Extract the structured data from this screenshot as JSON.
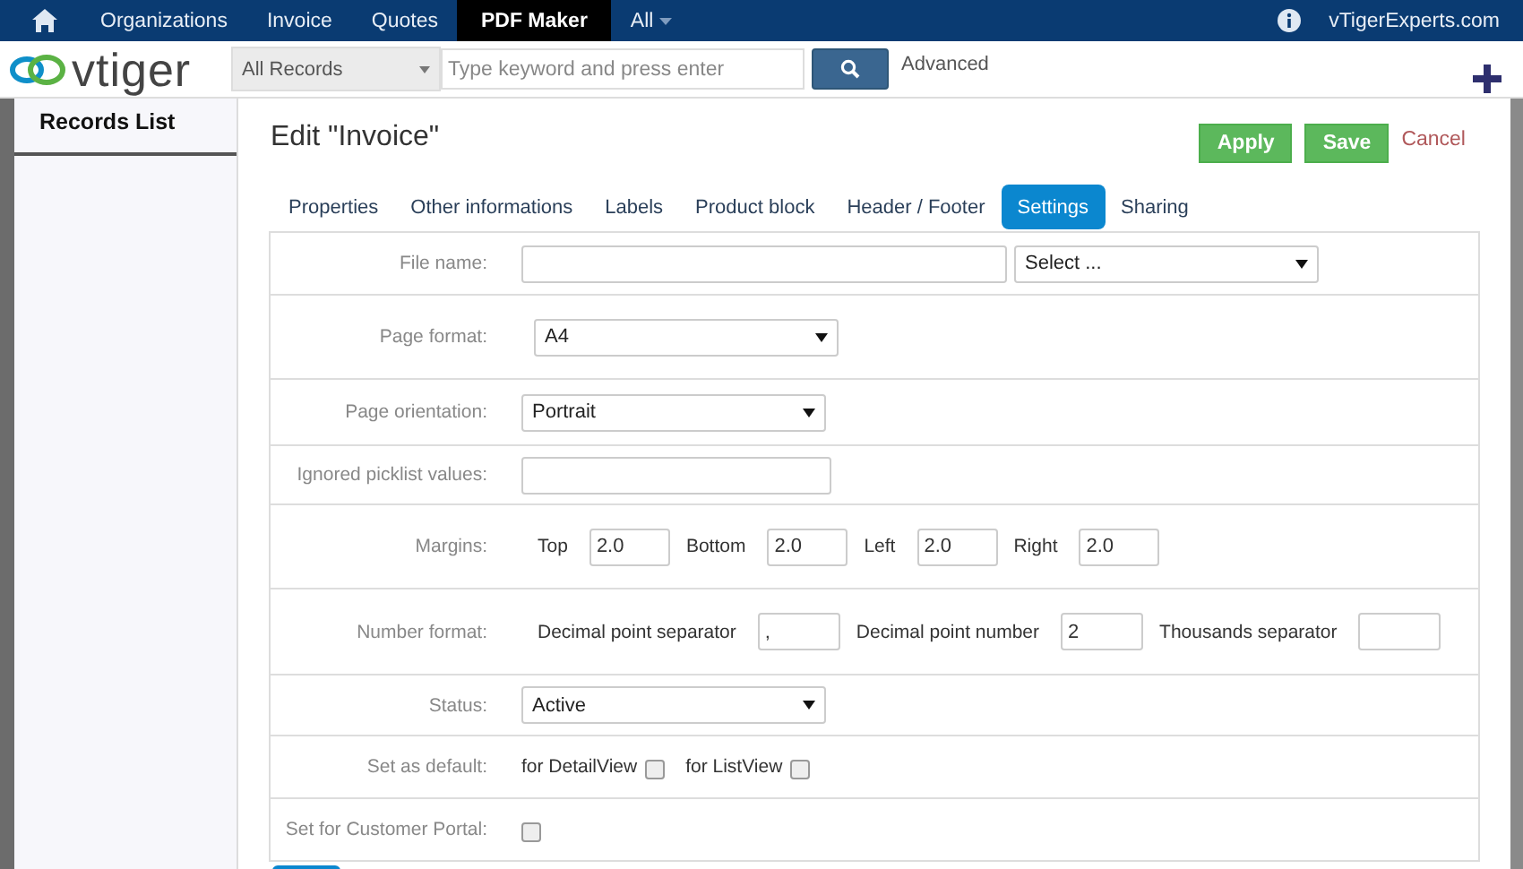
{
  "top_nav": {
    "items": [
      {
        "label": "Organizations",
        "selected": false
      },
      {
        "label": "Invoice",
        "selected": false
      },
      {
        "label": "Quotes",
        "selected": false
      },
      {
        "label": "PDF Maker",
        "selected": true
      },
      {
        "label": "All",
        "selected": false,
        "dropdown": true
      }
    ],
    "site": "vTigerExperts.com"
  },
  "header": {
    "logo": "vtiger",
    "search_scope": "All Records",
    "search": {
      "placeholder": "Type keyword and press enter"
    },
    "advanced": "Advanced"
  },
  "sidebar": {
    "title": "Records List"
  },
  "page_title": "Edit \"Invoice\"",
  "actions": [
    {
      "label": "Apply",
      "kind": "primary"
    },
    {
      "label": "Save",
      "kind": "primary"
    },
    {
      "label": "Cancel",
      "kind": "link"
    }
  ],
  "tabs": [
    {
      "label": "Properties",
      "selected": false
    },
    {
      "label": "Other informations",
      "selected": false
    },
    {
      "label": "Labels",
      "selected": false
    },
    {
      "label": "Product block",
      "selected": false
    },
    {
      "label": "Header / Footer",
      "selected": false
    },
    {
      "label": "Settings",
      "selected": true
    },
    {
      "label": "Sharing",
      "selected": false
    }
  ],
  "rows": [
    {
      "label": "File name:",
      "fields": [
        {
          "kind": "input"
        },
        {
          "kind": "select",
          "value": "Select ..."
        }
      ]
    },
    {
      "label": "Page format:",
      "fields": [
        {
          "kind": "select",
          "value": "A4"
        }
      ]
    },
    {
      "label": "Page orientation:",
      "fields": [
        {
          "kind": "select",
          "value": "Portrait"
        }
      ]
    },
    {
      "label": "Ignored picklist values:",
      "fields": [
        {
          "kind": "input"
        }
      ]
    },
    {
      "label": "Margins:",
      "fields": [
        {
          "kind": "small",
          "label": "Top",
          "value": "2.0"
        },
        {
          "kind": "small",
          "label": "Bottom",
          "value": "2.0"
        },
        {
          "kind": "small",
          "label": "Left",
          "value": "2.0"
        },
        {
          "kind": "small",
          "label": "Right",
          "value": "2.0"
        }
      ]
    },
    {
      "label": "Number format:",
      "fields": [
        {
          "kind": "small",
          "label": "Decimal point separator",
          "value": ","
        },
        {
          "kind": "small",
          "label": "Decimal point number",
          "value": "2"
        },
        {
          "kind": "small",
          "label": "Thousands separator"
        }
      ]
    },
    {
      "label": "Status:",
      "fields": [
        {
          "kind": "select",
          "value": "Active"
        }
      ]
    },
    {
      "label": "Set as default:",
      "fields": [
        {
          "kind": "checkbox",
          "label": "for DetailView",
          "checked": false
        },
        {
          "kind": "checkbox",
          "label": "for ListView",
          "checked": false
        }
      ]
    },
    {
      "label": "Set for Customer Portal:",
      "fields": [
        {
          "kind": "checkbox",
          "checked": false
        }
      ]
    }
  ]
}
